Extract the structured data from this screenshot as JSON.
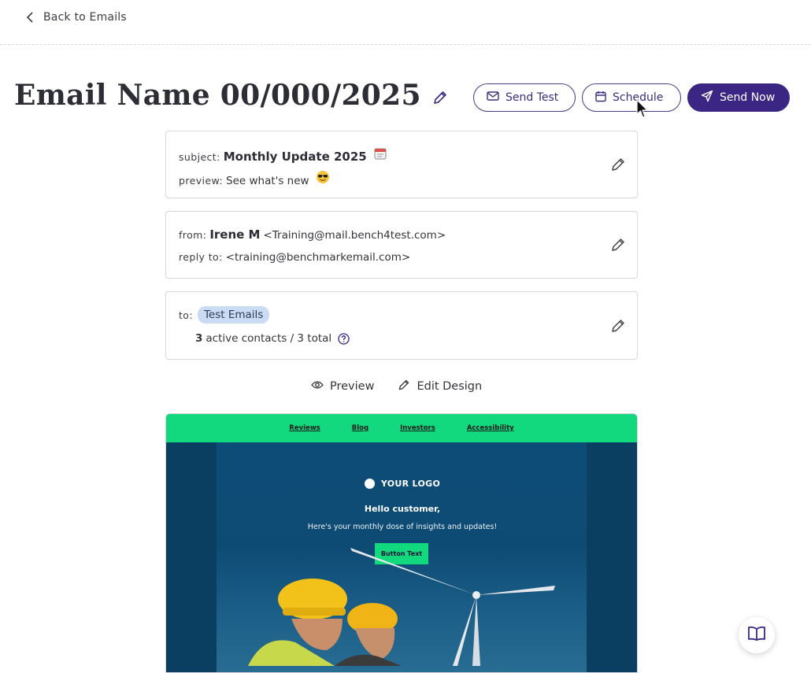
{
  "nav": {
    "back_label": "Back to Emails"
  },
  "header": {
    "title": "Email Name 00/000/2025"
  },
  "actions": {
    "send_test": "Send Test",
    "schedule": "Schedule",
    "send_now": "Send Now"
  },
  "subject_card": {
    "subject_label": "subject:",
    "subject_value": "Monthly Update 2025",
    "preview_label": "preview:",
    "preview_value": "See what's new"
  },
  "from_card": {
    "from_label": "from:",
    "from_name": "Irene M",
    "from_email": "<Training@mail.bench4test.com>",
    "reply_label": "reply to:",
    "reply_email": "<training@benchmarkemail.com>"
  },
  "to_card": {
    "to_label": "to:",
    "list_name": "Test Emails",
    "active_count": "3",
    "contacts_text": "active contacts / 3 total"
  },
  "design_actions": {
    "preview": "Preview",
    "edit_design": "Edit Design"
  },
  "email_preview": {
    "nav_links": [
      "Reviews",
      "Blog",
      "Investors",
      "Accessibility"
    ],
    "logo_text": "YOUR LOGO",
    "greeting": "Hello customer,",
    "intro": "Here's your monthly dose of insights and updates!",
    "button_text": "Button Text"
  },
  "colors": {
    "brand": "#3b2683",
    "accent_green": "#12d87e",
    "pill": "#c9dcf3"
  }
}
